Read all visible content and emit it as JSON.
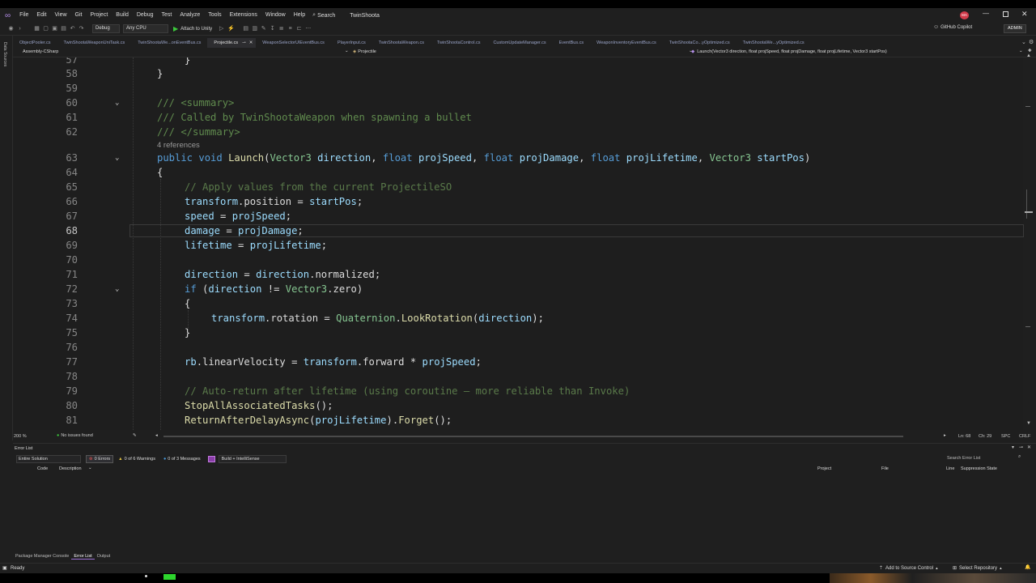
{
  "menubar": {
    "items": [
      "File",
      "Edit",
      "View",
      "Git",
      "Project",
      "Build",
      "Debug",
      "Test",
      "Analyze",
      "Tools",
      "Extensions",
      "Window",
      "Help"
    ],
    "search_label": "Search",
    "solution": "TwinShoota",
    "avatar": "MA"
  },
  "toolbar": {
    "config": "Debug",
    "platform": "Any CPU",
    "attach": "Attach to Unity",
    "copilot": "GitHub Copilot",
    "admin": "ADMIN"
  },
  "leftstrip": {
    "label": "Data Sources"
  },
  "tabs": [
    "ObjectPooler.cs",
    "TwinShootaWeaponUniTask.cs",
    "TwinShootaWe...onEventBus.cs",
    "Projectile.cs",
    "WeaponSelectorUIEventBus.cs",
    "PlayerInput.cs",
    "TwinShootaWeapon.cs",
    "TwinShootaControl.cs",
    "CustomUpdateManager.cs",
    "EventBus.cs",
    "WeaponInventoryEventBus.cs",
    "TwinShootaCo...yOptimized.cs",
    "TwinShootaWe...yOptimized.cs"
  ],
  "navbar": {
    "project": "Assembly-CSharp",
    "type": "Projectile",
    "member": "Launch(Vector3 direction, float projSpeed, float projDamage, float projLifetime, Vector3 startPos)"
  },
  "editor": {
    "line_numbers": [
      "57",
      "58",
      "59",
      "60",
      "61",
      "62",
      "63",
      "64",
      "65",
      "66",
      "67",
      "68",
      "69",
      "70",
      "71",
      "72",
      "73",
      "74",
      "75",
      "76",
      "77",
      "78",
      "79",
      "80",
      "81"
    ],
    "current_line": "68",
    "references_hint": "4 references",
    "lines": {
      "l57": "}",
      "l58": "}",
      "l60_doc": "/// <summary>",
      "l61_doc": "/// Called by TwinShootaWeapon when spawning a bullet",
      "l62_doc": "/// </summary>",
      "l63": {
        "public": "public",
        "void": "void",
        "name": "Launch",
        "t1": "Vector3",
        "p1": "direction",
        "t2": "float",
        "p2": "projSpeed",
        "t3": "float",
        "p3": "projDamage",
        "t4": "float",
        "p4": "projLifetime",
        "t5": "Vector3",
        "p5": "startPos"
      },
      "l64": "{",
      "l65": "// Apply values from the current ProjectileSO",
      "l66": {
        "a": "transform",
        "b": ".position = ",
        "c": "startPos",
        "d": ";"
      },
      "l67": {
        "a": "speed",
        "b": " = ",
        "c": "projSpeed",
        "d": ";"
      },
      "l68": {
        "a": "damage",
        "b": " = ",
        "c": "projDamage",
        "d": ";"
      },
      "l69": {
        "a": "lifetime",
        "b": " = ",
        "c": "projLifetime",
        "d": ";"
      },
      "l71": {
        "a": "direction",
        "b": " = ",
        "c": "direction",
        "d": ".normalized;"
      },
      "l72": {
        "kw": "if",
        "a": " (",
        "b": "direction",
        "c": " != ",
        "d": "Vector3",
        "e": ".zero)"
      },
      "l73": "{",
      "l74": {
        "a": "transform",
        "b": ".rotation = ",
        "c": "Quaternion",
        "d": ".",
        "e": "LookRotation",
        "f": "(",
        "g": "direction",
        "h": ");"
      },
      "l75": "}",
      "l77": {
        "a": "rb",
        "b": ".linearVelocity = ",
        "c": "transform",
        "d": ".forward * ",
        "e": "projSpeed",
        "f": ";"
      },
      "l79": "// Auto-return after lifetime (using coroutine — more reliable than Invoke)",
      "l80": {
        "fn": "StopAllAssociatedTasks",
        "rest": "();"
      },
      "l81": {
        "fn": "ReturnAfterDelayAsync",
        "a": "(",
        "b": "projLifetime",
        "c": ").",
        "d": "Forget",
        "e": "();"
      }
    }
  },
  "statusline": {
    "zoom": "200 %",
    "issues": "No issues found",
    "position": "Ln: 68",
    "column": "Ch: 29",
    "whitespace": "SPC",
    "line_ending": "CRLF"
  },
  "error_list": {
    "title": "Error List",
    "scope": "Entire Solution",
    "errors": "0 Errors",
    "warnings": "0 of 6 Warnings",
    "messages": "0 of 3 Messages",
    "build_filter": "Build + IntelliSense",
    "search_placeholder": "Search Error List",
    "columns": {
      "code": "Code",
      "description": "Description",
      "project": "Project",
      "file": "File",
      "line": "Line",
      "suppression": "Suppression State"
    }
  },
  "bottom_tabs": [
    "Package Manager Console",
    "Error List",
    "Output"
  ],
  "statusbar": {
    "ready": "Ready",
    "source_control": "Add to Source Control",
    "repository": "Select Repository"
  },
  "colors": {
    "accent_error": "#e05555",
    "avatar_bg": "#d13a4a",
    "play_green": "#3cc83c"
  }
}
